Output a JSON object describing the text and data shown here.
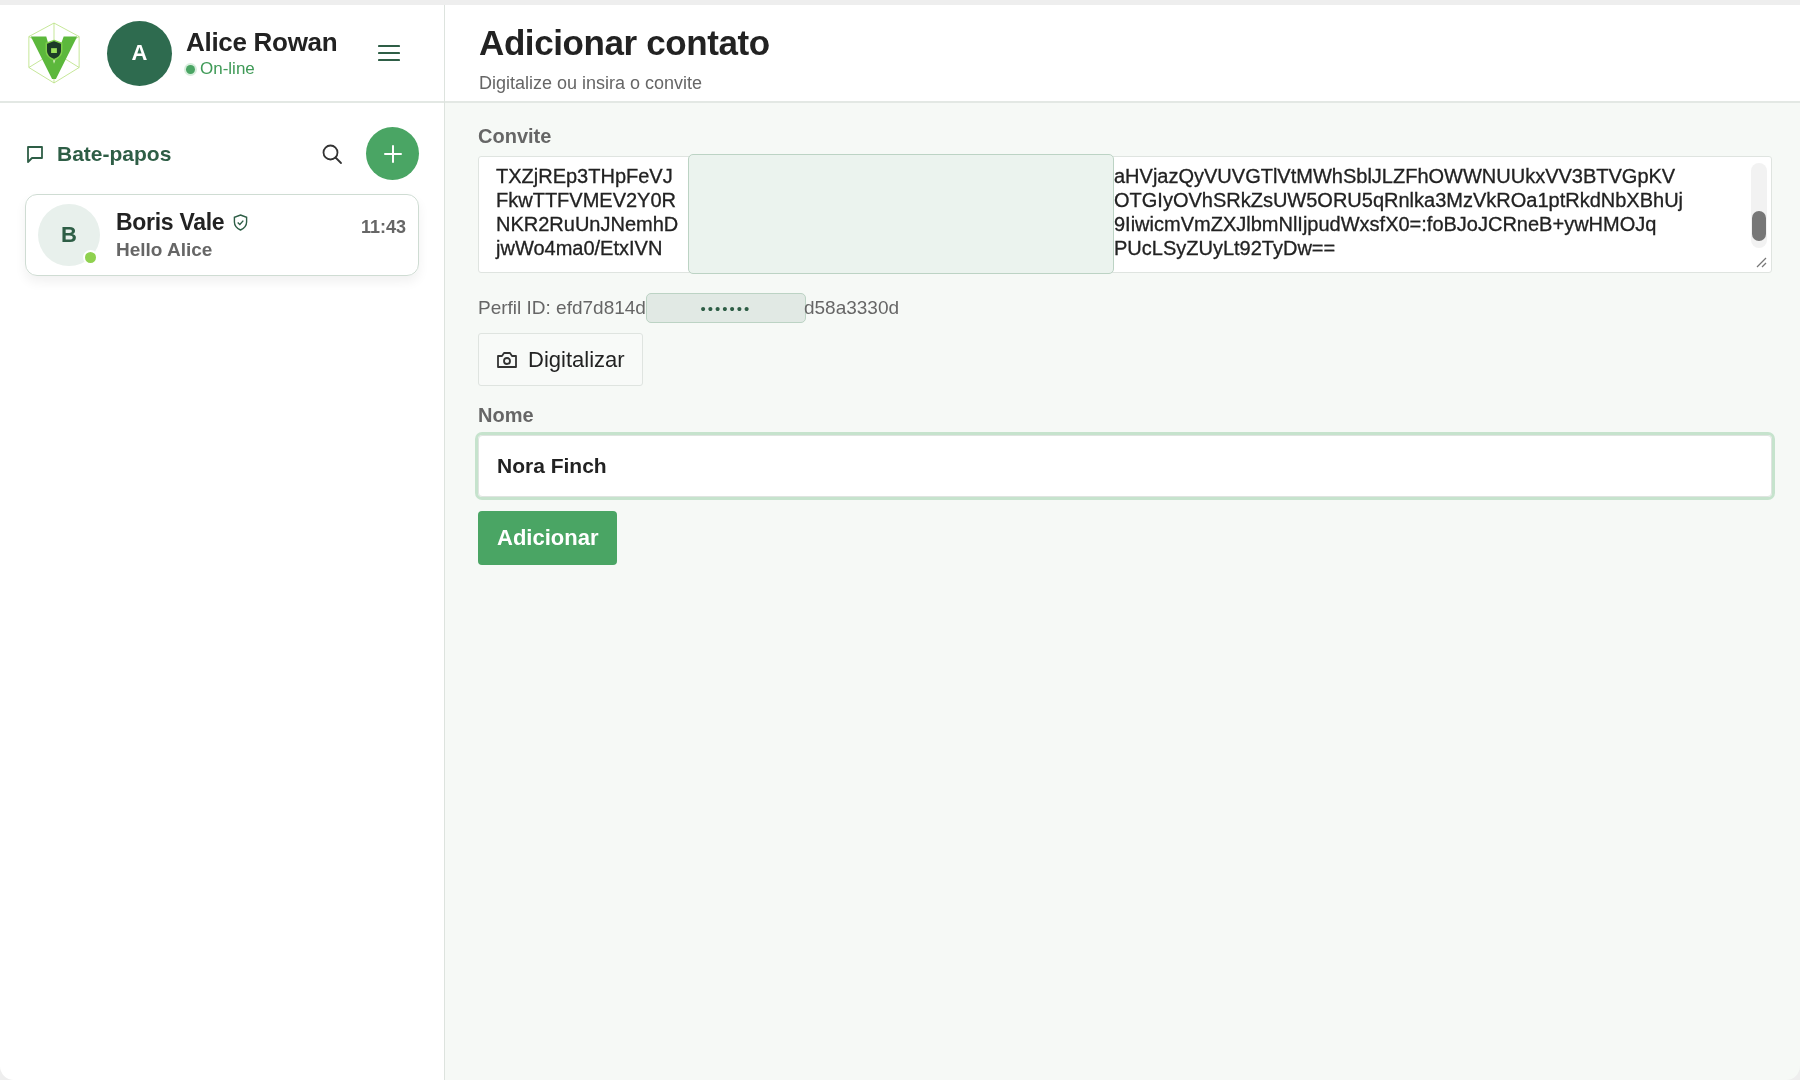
{
  "user": {
    "avatar_letter": "A",
    "name": "Alice Rowan",
    "status": "On-line"
  },
  "sidebar": {
    "title": "Bate-papos",
    "chats": [
      {
        "avatar_letter": "B",
        "name": "Boris Vale",
        "verified": true,
        "online": true,
        "preview": "Hello Alice",
        "time": "11:43",
        "selected": true
      }
    ]
  },
  "page": {
    "title": "Adicionar contato",
    "subtitle": "Digitalize ou insira o convite"
  },
  "form": {
    "invite_label": "Convite",
    "invite_lines": [
      {
        "left": "TXZjREp3THpFeVJ",
        "right": "aHVjazQyVUVGTlVtMWhSblJLZFhOWWNUUkxVV3BTVGpKV"
      },
      {
        "left": "FkwTTFVMEV2Y0R",
        "right": "OTGIyOVhSRkZsUW5ORU5qRnlka3MzVkROa1ptRkdNbXBhUj"
      },
      {
        "left": "NKR2RuUnJNemhD",
        "right": "9IiwicmVmZXJlbmNlIjpudWxsfX0=:foBJoJCRneB+ywHMOJq"
      },
      {
        "left": "jwWo4ma0/EtxIVN",
        "right": "PUcLSyZUyLt92TyDw=="
      }
    ],
    "profile_id": {
      "label": "Perfil ID:",
      "start": "efd7d814d",
      "masked": "•••••••",
      "end": "d58a3330d"
    },
    "scan_button": "Digitalizar",
    "name_label": "Nome",
    "name_value": "Nora Finch",
    "submit_button": "Adicionar"
  }
}
